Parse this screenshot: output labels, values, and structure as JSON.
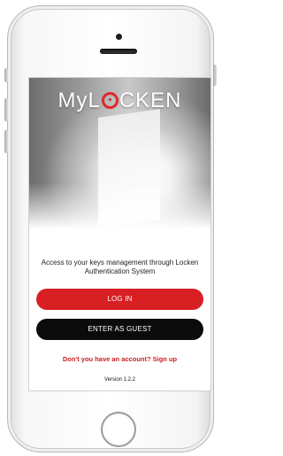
{
  "app": {
    "brand": {
      "prefix": "My",
      "middle": "L",
      "suffix": "CKEN"
    },
    "tagline": "Access to your keys management through Locken Authentication System",
    "buttons": {
      "login": "LOG IN",
      "guest": "ENTER AS GUEST"
    },
    "signup_prompt": "Don't you have an account? Sign up",
    "version": "Version 1.2.2"
  },
  "colors": {
    "accent": "#d71f24",
    "guest_button": "#0b0b0b",
    "link": "#cc1f23"
  }
}
